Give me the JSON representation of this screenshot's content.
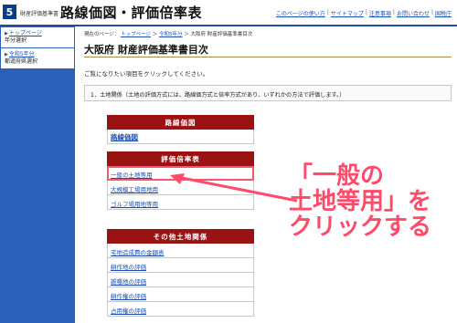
{
  "header": {
    "logo_number": "5",
    "logo_sub": "財産評価基準書",
    "title": "路線価図・評価倍率表",
    "links": [
      "このページの使い方",
      "サイトマップ",
      "注意事項",
      "お問い合わせ",
      "国税庁"
    ]
  },
  "sidebar": {
    "items": [
      {
        "link": "トップページ",
        "sub": "年分選択"
      },
      {
        "link": "令和5年分",
        "sub": "都道府県選択"
      }
    ]
  },
  "breadcrumb": {
    "prefix": "現在のページ：",
    "items": [
      "トップページ",
      "令和5年分"
    ],
    "current": "大阪府 財産評価基準書目次"
  },
  "main": {
    "title": "大阪府 財産評価基準書目次",
    "intro": "ご覧になりたい項目をクリックしてください。",
    "section1": "1．土地関係（土地の評価方式には、路線価方式と倍率方式があり、いずれかの方法で評価します。）"
  },
  "groups": [
    {
      "header": "路線価図",
      "items": [
        "路線価図"
      ]
    },
    {
      "header": "評価倍率表",
      "items": [
        "一般の土地等用",
        "大規模工場用地用",
        "ゴルフ場用地等用"
      ]
    },
    {
      "header": "その他土地関係",
      "items": [
        "宅地造成費の金額表",
        "耕作地の評価",
        "雑種地の評価",
        "耕作権の評価",
        "占用権の評価"
      ]
    }
  ],
  "annotation": {
    "lines": [
      "「一般の",
      "土地等用」を",
      "クリックする"
    ],
    "color": "#ff4a6a"
  },
  "colors": {
    "brand": "#0a3d8a",
    "nav_bg": "#2b5fb8",
    "group_header": "#9a1212",
    "link": "#1a4fb5"
  }
}
